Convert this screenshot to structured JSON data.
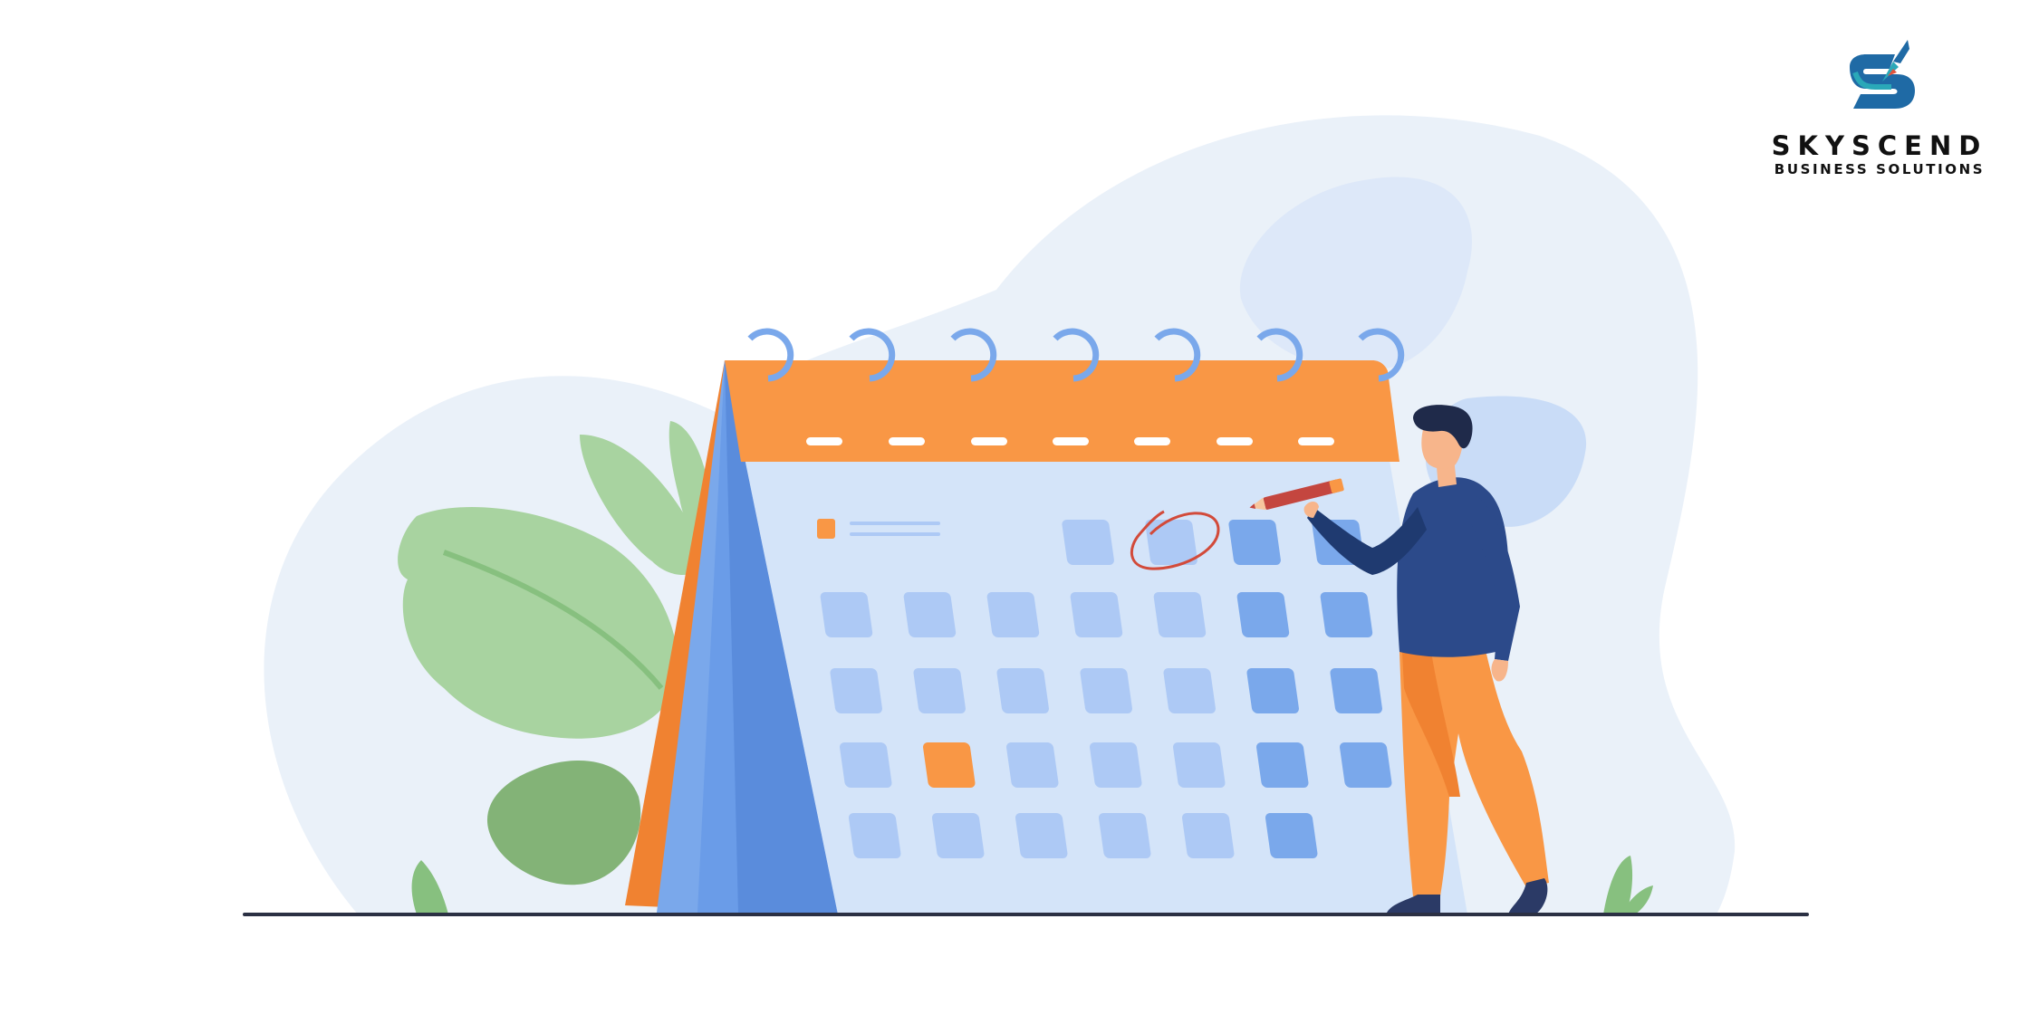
{
  "brand": {
    "name": "SKYSCEND",
    "tagline": "BUSINESS SOLUTIONS",
    "logo_icon": "skyscend-rocket-logo-icon"
  },
  "illustration": {
    "subject": "calendar-planning-illustration",
    "colors": {
      "background_blob": "#eaf1f9",
      "calendar_header": "#f99745",
      "calendar_page": "#d4e4f9",
      "calendar_cell": "#adc9f5",
      "calendar_cell_dark": "#7aa8eb",
      "highlight_cell": "#f99745",
      "person_shirt": "#2c4a8a",
      "person_pants": "#f99745",
      "leaf_green": "#a8d3a0",
      "ground_line": "#2b3043"
    }
  }
}
